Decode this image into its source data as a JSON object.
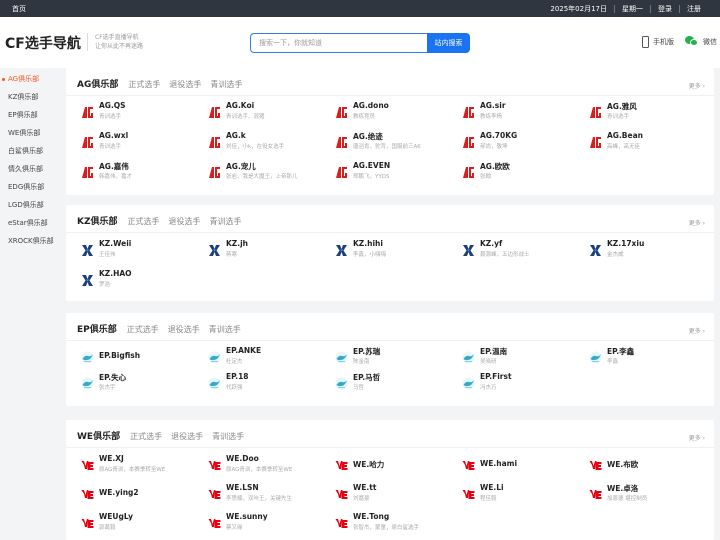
{
  "topbar": {
    "home": "首页",
    "date": "2025年02月17日",
    "weekday": "星期一",
    "login": "登录",
    "register": "注册"
  },
  "header": {
    "logo": "CF选手导航",
    "tagline_1": "CF选手直播导航",
    "tagline_2": "让你从此不再迷路",
    "search_placeholder": "搜索一下，你就知道",
    "search_button": "站内搜索",
    "mobile": "手机版",
    "wechat": "微信"
  },
  "sidebar": {
    "items": [
      "AG俱乐部",
      "KZ俱乐部",
      "EP俱乐部",
      "WE俱乐部",
      "白鲨俱乐部",
      "情久俱乐部",
      "EDG俱乐部",
      "LGD俱乐部",
      "eStar俱乐部",
      "XROCK俱乐部"
    ]
  },
  "colors": {
    "accent": "#1a73f0",
    "active": "#f05a22",
    "ag_red": "#d81e1e",
    "we_red": "#e60012",
    "kz_blue": "#1f3f7a",
    "ep_teal": "#33aacc"
  },
  "clubs": [
    {
      "title": "AG俱乐部",
      "tabs": [
        "正式选手",
        "退役选手",
        "青训选手"
      ],
      "more": "更多 ›",
      "logo": "ag-logo",
      "players": [
        {
          "name": "AG.QS",
          "desc": "青训选手"
        },
        {
          "name": "AG.Koi",
          "desc": "青训选手、混猪"
        },
        {
          "name": "AG.dono",
          "desc": "教练竞员"
        },
        {
          "name": "AG.sir",
          "desc": "教练李杨"
        },
        {
          "name": "AG.雅风",
          "desc": "青训选手"
        },
        {
          "name": "AG.wxl",
          "desc": "青训选手"
        },
        {
          "name": "AG.k",
          "desc": "刘佳，小k，在役女选手"
        },
        {
          "name": "AG.绝迹",
          "desc": "唐滔肯，驼背，国服前三AK"
        },
        {
          "name": "AG.70KG",
          "desc": "郝尚，敬坤"
        },
        {
          "name": "AG.Bean",
          "desc": "高峰，高无臣"
        },
        {
          "name": "AG.嘉伟",
          "desc": "韩嘉伟，嘉才"
        },
        {
          "name": "AG.宠儿",
          "desc": "张岩，我是大魔王，上帝那儿"
        },
        {
          "name": "AG.EVEN",
          "desc": "郑鹏飞，YYDS"
        },
        {
          "name": "AG.欧欧",
          "desc": "张翰"
        }
      ]
    },
    {
      "title": "KZ俱乐部",
      "tabs": [
        "正式选手",
        "退役选手",
        "青训选手"
      ],
      "more": "更多 ›",
      "logo": "kz-logo",
      "players": [
        {
          "name": "KZ.Weii",
          "desc": "王佳伟"
        },
        {
          "name": "KZ.jh",
          "desc": "蒋寒"
        },
        {
          "name": "KZ.hihi",
          "desc": "李鑫，小嗨嗨"
        },
        {
          "name": "KZ.yf",
          "desc": "聂源峰，五边形战士"
        },
        {
          "name": "KZ.17xiu",
          "desc": "金杰威"
        },
        {
          "name": "KZ.HAO",
          "desc": "罗浩"
        }
      ]
    },
    {
      "title": "EP俱乐部",
      "tabs": [
        "正式选手",
        "退役选手",
        "青训选手"
      ],
      "more": "更多 ›",
      "logo": "ep-logo",
      "players": [
        {
          "name": "EP.Bigfish",
          "desc": ""
        },
        {
          "name": "EP.ANKE",
          "desc": "杜定杰"
        },
        {
          "name": "EP.苏瑞",
          "desc": "陈金南"
        },
        {
          "name": "EP.温南",
          "desc": "吴晓研"
        },
        {
          "name": "EP.李鑫",
          "desc": "李鑫"
        },
        {
          "name": "EP.失心",
          "desc": "张杰宇"
        },
        {
          "name": "EP.18",
          "desc": "代跃强"
        },
        {
          "name": "EP.马哲",
          "desc": "马哲"
        },
        {
          "name": "EP.First",
          "desc": "冯杰万"
        }
      ]
    },
    {
      "title": "WE俱乐部",
      "tabs": [
        "正式选手",
        "退役选手",
        "青训选手"
      ],
      "more": "更多 ›",
      "logo": "we-logo",
      "players": [
        {
          "name": "WE.XJ",
          "desc": "原AG青训，本赛季转至WE"
        },
        {
          "name": "WE.Doo",
          "desc": "原AG青训，本赛季转至WE"
        },
        {
          "name": "WE.哈力",
          "desc": ""
        },
        {
          "name": "WE.hami",
          "desc": ""
        },
        {
          "name": "WE.布欧",
          "desc": ""
        },
        {
          "name": "WE.ying2",
          "desc": ""
        },
        {
          "name": "WE.LSN",
          "desc": "李思楠，双咔王，关键先生"
        },
        {
          "name": "WE.tt",
          "desc": "刘嘉豪"
        },
        {
          "name": "WE.Li",
          "desc": "程佳毅"
        },
        {
          "name": "WE.卓洛",
          "desc": "加恩德 堪控制员"
        },
        {
          "name": "WEUgLy",
          "desc": "郭葛毅"
        },
        {
          "name": "WE.sunny",
          "desc": "蔡又缘"
        },
        {
          "name": "WE.Tong",
          "desc": "张智杰，蒙童，原白鲨选手"
        }
      ]
    }
  ]
}
